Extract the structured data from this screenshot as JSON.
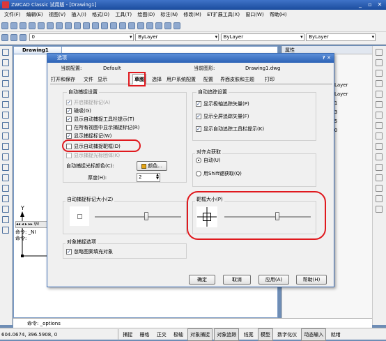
{
  "app": {
    "title": "ZWCAD Classic 试用版 - [Drawing1]"
  },
  "menu": [
    "文件(F)",
    "编辑(E)",
    "视图(V)",
    "插入(I)",
    "格式(O)",
    "工具(T)",
    "绘图(D)",
    "标注(N)",
    "修改(M)",
    "ET扩展工具(X)",
    "窗口(W)",
    "帮助(H)"
  ],
  "layer_toolbar": {
    "color_value": "ByLayer",
    "linetype_value": "ByLayer",
    "lineweight_value": "ByLayer",
    "layer_value": "0"
  },
  "drawing_tab": {
    "label": "Drawing1"
  },
  "properties": {
    "title": "属性",
    "items": [
      "ByLayer",
      "ByLayer",
      "181",
      "153",
      "255",
      "100"
    ]
  },
  "command": {
    "line1": "命令: _NI",
    "line2": "命令:",
    "current_prompt": "命令: _options"
  },
  "status": {
    "coords": "604.0674, 396.5908, 0",
    "buttons": [
      "捕捉",
      "栅格",
      "正交",
      "极轴",
      "对象捕捉",
      "对象追踪",
      "线宽",
      "模型",
      "数字化仪",
      "动态输入",
      "就绪"
    ],
    "on": [
      "对象捕捉",
      "对象追踪",
      "模型",
      "动态输入"
    ]
  },
  "dialog": {
    "title": "选项",
    "current_config_label": "当前配置:",
    "current_config_value": "Default",
    "current_drawing_label": "当前图形:",
    "current_drawing_value": "Drawing1.dwg",
    "tabs": [
      "打开和保存",
      "文件",
      "显示",
      "草图",
      "选择",
      "用户系统配置",
      "配置",
      "界面皮肤和主题",
      "打印"
    ],
    "active_tab": "草图",
    "autosnap": {
      "title": "自动捕捉设置",
      "options": [
        {
          "label": "开启捕捉标记(A)",
          "checked": true,
          "disabled": true
        },
        {
          "label": "磁吸(G)",
          "checked": true,
          "disabled": false
        },
        {
          "label": "显示自动捕捉工具栏提示(T)",
          "checked": true,
          "disabled": false
        },
        {
          "label": "在所有视图中显示捕捉标记(R)",
          "checked": false,
          "disabled": false
        },
        {
          "label": "显示捕捉标记(W)",
          "checked": true,
          "disabled": false
        },
        {
          "label": "显示自动捕捉靶框(D)",
          "checked": false,
          "disabled": false
        },
        {
          "label": "显示捕捉光标团体(K)",
          "checked": false,
          "disabled": true
        }
      ],
      "marker_color_label": "自动捕捉光标颜色(C):",
      "color_button_label": "颜色...",
      "thickness_label": "厚度(H):",
      "thickness_value": "2"
    },
    "autotrack": {
      "title": "自动追踪设置",
      "options": [
        {
          "label": "显示极轴追踪矢量(P)",
          "checked": true
        },
        {
          "label": "显示全屏追踪矢量(F)",
          "checked": true
        },
        {
          "label": "显示自动追踪工具栏提示(K)",
          "checked": true
        }
      ]
    },
    "alignment": {
      "title": "对齐点获取",
      "options": [
        {
          "label": "自动(U)",
          "selected": true
        },
        {
          "label": "用Shift键获取(Q)",
          "selected": false
        }
      ]
    },
    "marker_size": {
      "title": "自动捕捉标记大小(Z)",
      "value_fraction": 0.6
    },
    "aperture_size": {
      "title": "靶框大小(P)",
      "value_fraction": 0.62
    },
    "object_snap": {
      "title": "对象捕捉选项",
      "option_label": "忽略图案填充对象",
      "checked": true
    },
    "buttons": {
      "ok": "确定",
      "cancel": "取消",
      "apply": "应用(A)",
      "help": "帮助(H)"
    }
  },
  "colors": {
    "accent": "#2c62b6",
    "highlight": "#e0191e"
  }
}
